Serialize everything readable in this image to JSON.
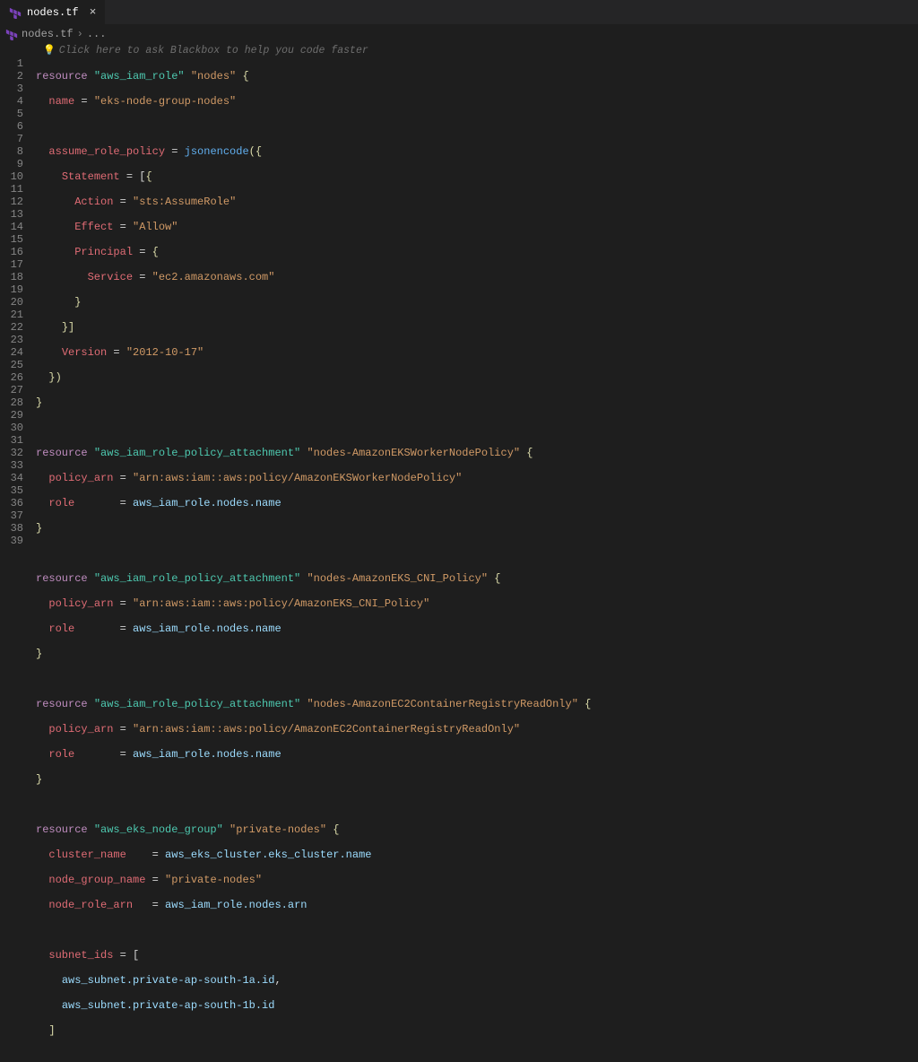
{
  "tab": {
    "filename": "nodes.tf",
    "close": "×"
  },
  "breadcrumb": {
    "filename": "nodes.tf",
    "trail": "..."
  },
  "hint": {
    "bulb": "💡",
    "text": "Click here to ask Blackbox to help you code faster"
  },
  "lineNumbers": [
    "1",
    "2",
    "3",
    "4",
    "5",
    "6",
    "7",
    "8",
    "9",
    "10",
    "11",
    "12",
    "13",
    "14",
    "15",
    "16",
    "17",
    "18",
    "19",
    "20",
    "21",
    "22",
    "23",
    "24",
    "25",
    "26",
    "27",
    "28",
    "29",
    "30",
    "31",
    "32",
    "33",
    "34",
    "35",
    "36",
    "37",
    "38",
    "39"
  ],
  "code": {
    "r1": {
      "kw": "resource",
      "type": "\"aws_iam_role\"",
      "name": "\"nodes\"",
      "br": "{"
    },
    "l2": {
      "prop": "name",
      "eq": " = ",
      "val": "\"eks-node-group-nodes\""
    },
    "l4": {
      "prop": "assume_role_policy",
      "eq": " = ",
      "fn": "jsonencode",
      "paren": "({"
    },
    "l5": {
      "prop": "Statement",
      "eq": " = [",
      "br": "{"
    },
    "l6": {
      "prop": "Action",
      "eq": " = ",
      "val": "\"sts:AssumeRole\""
    },
    "l7": {
      "prop": "Effect",
      "eq": " = ",
      "val": "\"Allow\""
    },
    "l8": {
      "prop": "Principal",
      "eq": " = ",
      "br": "{"
    },
    "l9": {
      "prop": "Service",
      "eq": " = ",
      "val": "\"ec2.amazonaws.com\""
    },
    "l10": {
      "br": "}"
    },
    "l11": {
      "br": "}]"
    },
    "l12": {
      "prop": "Version",
      "eq": " = ",
      "val": "\"2012-10-17\""
    },
    "l13": {
      "br": "})"
    },
    "l14": {
      "br": "}"
    },
    "r16": {
      "kw": "resource",
      "type": "\"aws_iam_role_policy_attachment\"",
      "name": "\"nodes-AmazonEKSWorkerNodePolicy\"",
      "br": "{"
    },
    "l17": {
      "prop": "policy_arn",
      "eq": " = ",
      "val": "\"arn:aws:iam::aws:policy/AmazonEKSWorkerNodePolicy\""
    },
    "l18": {
      "prop": "role",
      "pad": "       = ",
      "ref": "aws_iam_role.nodes.name"
    },
    "l19": {
      "br": "}"
    },
    "r21": {
      "kw": "resource",
      "type": "\"aws_iam_role_policy_attachment\"",
      "name": "\"nodes-AmazonEKS_CNI_Policy\"",
      "br": "{"
    },
    "l22": {
      "prop": "policy_arn",
      "eq": " = ",
      "val": "\"arn:aws:iam::aws:policy/AmazonEKS_CNI_Policy\""
    },
    "l23": {
      "prop": "role",
      "pad": "       = ",
      "ref": "aws_iam_role.nodes.name"
    },
    "l24": {
      "br": "}"
    },
    "r26": {
      "kw": "resource",
      "type": "\"aws_iam_role_policy_attachment\"",
      "name": "\"nodes-AmazonEC2ContainerRegistryReadOnly\"",
      "br": "{"
    },
    "l27": {
      "prop": "policy_arn",
      "eq": " = ",
      "val": "\"arn:aws:iam::aws:policy/AmazonEC2ContainerRegistryReadOnly\""
    },
    "l28": {
      "prop": "role",
      "pad": "       = ",
      "ref": "aws_iam_role.nodes.name"
    },
    "l29": {
      "br": "}"
    },
    "r31": {
      "kw": "resource",
      "type": "\"aws_eks_node_group\"",
      "name": "\"private-nodes\"",
      "br": "{"
    },
    "l32": {
      "prop": "cluster_name",
      "pad": "    = ",
      "ref": "aws_eks_cluster.eks_cluster.name"
    },
    "l33": {
      "prop": "node_group_name",
      "eq": " = ",
      "val": "\"private-nodes\""
    },
    "l34": {
      "prop": "node_role_arn",
      "pad": "   = ",
      "ref": "aws_iam_role.nodes.arn"
    },
    "l36": {
      "prop": "subnet_ids",
      "eq": " = [",
      "br": ""
    },
    "l37": {
      "ref": "aws_subnet.private-ap-south-1a.id",
      "comma": ","
    },
    "l38": {
      "ref": "aws_subnet.private-ap-south-1b.id"
    },
    "l39": {
      "br": "]"
    }
  }
}
